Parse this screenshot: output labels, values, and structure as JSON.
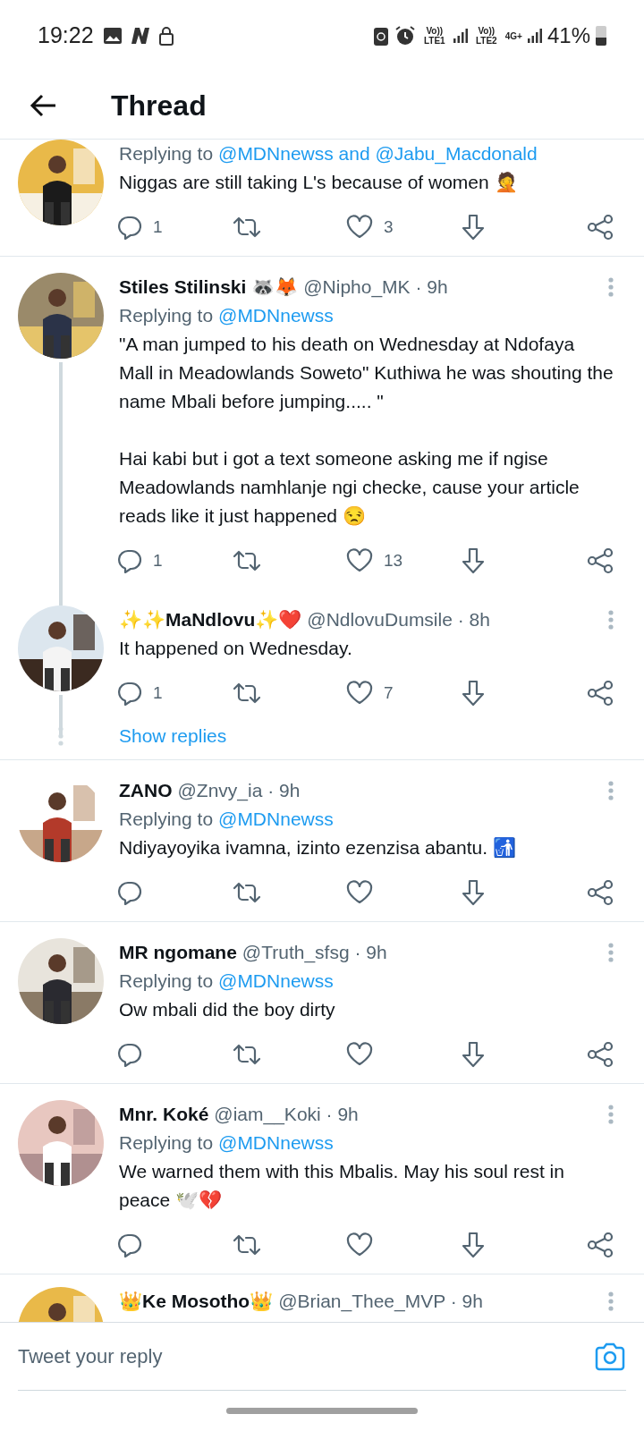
{
  "status_bar": {
    "time": "19:22",
    "network_1": "Vo)) LTE1",
    "network_2": "Vo)) LTE2",
    "data": "4G+",
    "battery": "41%"
  },
  "header": {
    "title": "Thread"
  },
  "groups": [
    {
      "items": [
        {
          "kind": "tweet",
          "replying_label": "Replying to",
          "replying_to": "@MDNnewss and @Jabu_Macdonald",
          "text": "Niggas are still taking L's because of women 🤦",
          "replies": "1",
          "likes": "3",
          "thread_line": false
        }
      ]
    },
    {
      "items": [
        {
          "kind": "tweet",
          "name": "Stiles Stilinski 🦝🦊",
          "handle": "@Nipho_MK · 9h",
          "replying_label": "Replying to",
          "replying_to": "@MDNnewss",
          "text": "\"A man jumped to his death on Wednesday at Ndofaya Mall in Meadowlands Soweto\" Kuthiwa he was shouting the name Mbali before jumping..... \"\n\nHai kabi but i got a text someone asking me if ngise Meadowlands namhlanje ngi checke, cause your article reads like it just happened 😒",
          "replies": "1",
          "likes": "13",
          "thread_line": true
        },
        {
          "kind": "tweet",
          "name": "✨✨MaNdlovu✨❤️",
          "handle": "@NdlovuDumsile · 8h",
          "text": "It happened on Wednesday.",
          "replies": "1",
          "likes": "7",
          "thread_line": true
        },
        {
          "kind": "show_replies",
          "label": "Show replies"
        }
      ]
    },
    {
      "items": [
        {
          "kind": "tweet",
          "name": "ZANO",
          "handle": "@Znvy_ia · 9h",
          "replying_label": "Replying to",
          "replying_to": "@MDNnewss",
          "text": "Ndiyayoyika ivamna, izinto ezenzisa abantu. 🚮",
          "thread_line": false
        }
      ]
    },
    {
      "items": [
        {
          "kind": "tweet",
          "name": "MR ngomane",
          "handle": "@Truth_sfsg · 9h",
          "replying_label": "Replying to",
          "replying_to": "@MDNnewss",
          "text": "Ow mbali did the boy dirty",
          "thread_line": false
        }
      ]
    },
    {
      "items": [
        {
          "kind": "tweet",
          "name": "Mnr. Koké",
          "handle": "@iam__Koki · 9h",
          "replying_label": "Replying to",
          "replying_to": "@MDNnewss",
          "text": "We warned them with this Mbalis. May his soul rest in peace 🕊️💔",
          "thread_line": false
        }
      ]
    },
    {
      "items": [
        {
          "kind": "partial",
          "name": "👑Ke Mosotho👑",
          "handle": "@Brian_Thee_MVP · 9h"
        }
      ]
    }
  ],
  "reply_bar": {
    "placeholder": "Tweet your reply"
  }
}
